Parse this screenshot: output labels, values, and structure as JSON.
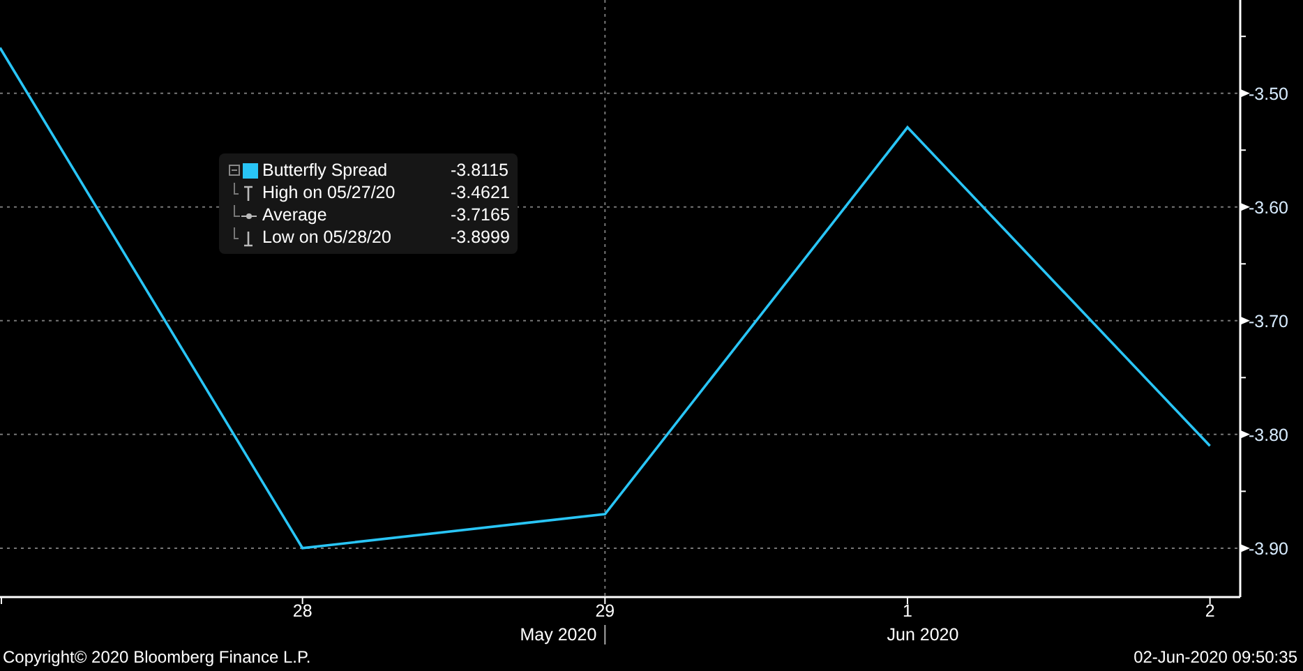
{
  "chart": {
    "chart_data": {
      "type": "line",
      "grid": true,
      "categories": [
        null,
        "28",
        "29",
        "1",
        "2"
      ],
      "ylim": [
        -3.943,
        -3.418
      ],
      "yticks": [
        {
          "value": -3.5,
          "label": "-3.50"
        },
        {
          "value": -3.6,
          "label": "-3.60"
        },
        {
          "value": -3.7,
          "label": "-3.70"
        },
        {
          "value": -3.8,
          "label": "-3.80"
        },
        {
          "value": -3.9,
          "label": "-3.90"
        }
      ],
      "series": [
        {
          "name": "Butterfly Spread",
          "color": "#29c5f6",
          "values": [
            -3.46,
            -3.9,
            -3.87,
            -3.53,
            -3.81
          ]
        }
      ]
    },
    "period_labels": [
      "May 2020",
      "Jun 2020"
    ]
  },
  "legend": {
    "items": [
      {
        "kind": "series",
        "value": "-3.8115"
      },
      {
        "kind": "high",
        "label": "High on 05/27/20",
        "value": "-3.4621"
      },
      {
        "kind": "average",
        "label": "Average",
        "value": "-3.7165"
      },
      {
        "kind": "low",
        "label": "Low on 05/28/20",
        "value": "-3.8999"
      }
    ]
  },
  "footer": {
    "copyright": "Copyright© 2020 Bloomberg Finance L.P.",
    "timestamp": "02-Jun-2020 09:50:35"
  }
}
